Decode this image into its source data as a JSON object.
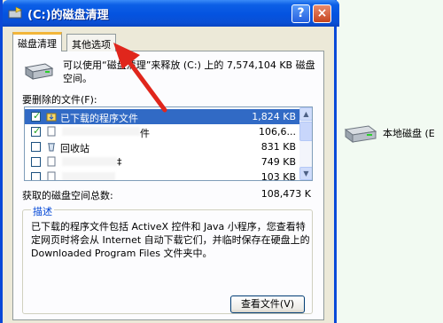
{
  "window": {
    "title": "(C:)的磁盘清理",
    "help_label": "?",
    "close_label": "×"
  },
  "tabs": [
    {
      "label": "磁盘清理",
      "active": true
    },
    {
      "label": "其他选项",
      "active": false
    }
  ],
  "intro_text": "可以使用“磁盘清理”来释放 (C:) 上的 7,574,104 KB 磁盘空间。",
  "files_label": "要删除的文件(F):",
  "files": [
    {
      "name": "已下载的程序文件",
      "size": "1,824 KB",
      "checked": true,
      "selected": true,
      "icon": "folder-download-icon"
    },
    {
      "name": "件",
      "size": "106,6...",
      "checked": true,
      "selected": false,
      "icon": "file-icon"
    },
    {
      "name": "回收站",
      "size": "831 KB",
      "checked": false,
      "selected": false,
      "icon": "recycle-bin-icon"
    },
    {
      "name": "‡",
      "size": "749 KB",
      "checked": false,
      "selected": false,
      "icon": "file-icon"
    },
    {
      "name": "",
      "size": "103 KB",
      "checked": false,
      "selected": false,
      "icon": "file-icon"
    }
  ],
  "total_label": "获取的磁盘空间总数:",
  "total_value": "108,473 K",
  "description": {
    "title": "描述",
    "text": "已下载的程序文件包括 ActiveX 控件和 Java 小程序，您查看特定网页时将会从 Internet 自动下载它们，并临时保存在硬盘上的 Downloaded Program Files 文件夹中。"
  },
  "view_files_button": "查看文件(V)",
  "background": {
    "drive_label": "本地磁盘 (E"
  },
  "colors": {
    "titlebar": "#0453e0",
    "selection": "#316ac5",
    "annotation_arrow": "#e0261c"
  }
}
